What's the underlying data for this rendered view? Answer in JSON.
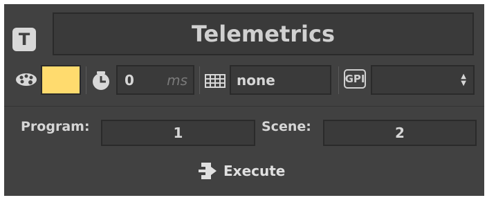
{
  "title": "Telemetrics",
  "title_icon_letter": "T",
  "colors": {
    "panel": "#414141",
    "swatch": "#ffdb6e",
    "text": "#d6d6d6"
  },
  "delay": {
    "value": "0",
    "unit": "ms"
  },
  "keyboard": {
    "value": "none"
  },
  "gpi": {
    "icon_label": "GPI",
    "selected": ""
  },
  "program": {
    "label": "Program:",
    "value": "1"
  },
  "scene": {
    "label": "Scene:",
    "value": "2"
  },
  "execute": {
    "label": "Execute"
  },
  "icons": [
    "title-t-icon",
    "palette-icon",
    "clock-icon",
    "keyboard-icon",
    "gpi-icon",
    "execute-icon"
  ]
}
